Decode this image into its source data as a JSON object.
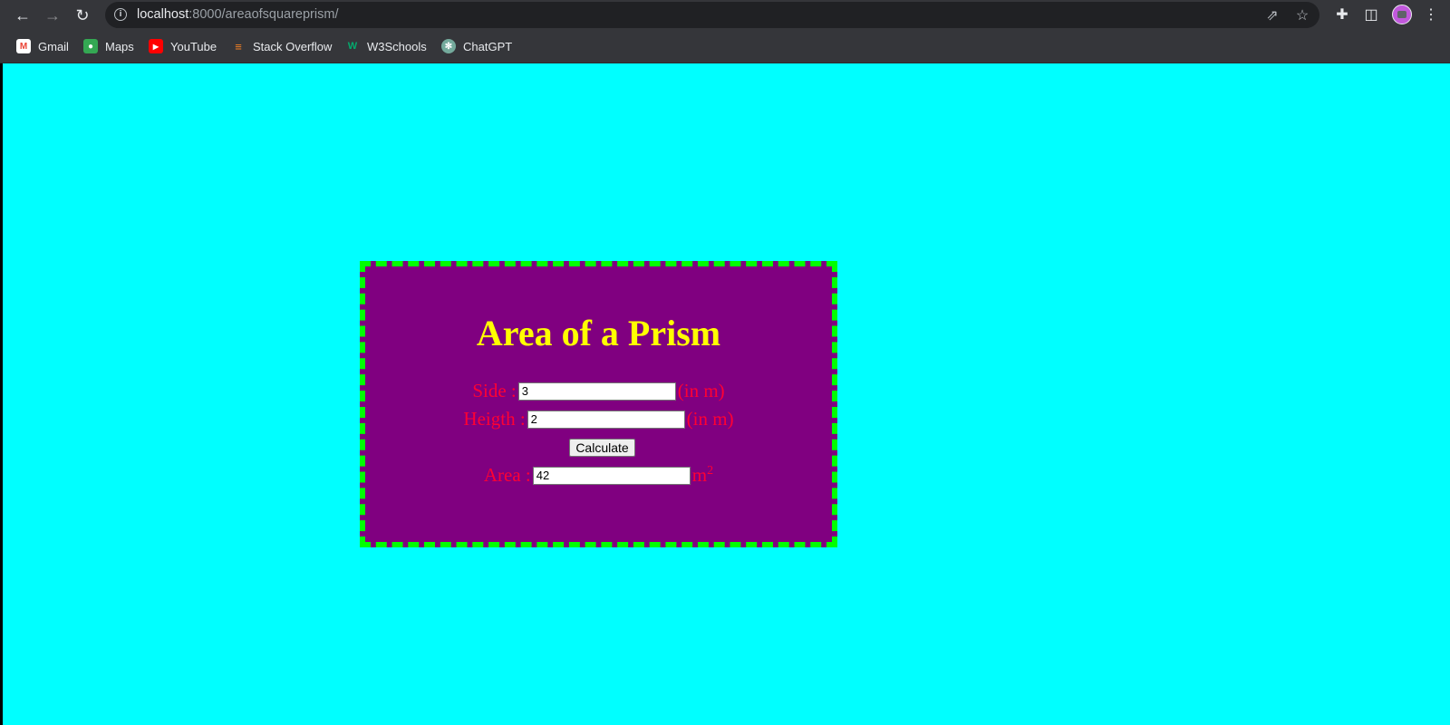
{
  "browser": {
    "url_host": "localhost",
    "url_path": ":8000/areaofsquareprism/",
    "bookmarks": [
      {
        "label": "Gmail",
        "icon": "gmail-icon",
        "color": "#ea4335"
      },
      {
        "label": "Maps",
        "icon": "maps-icon",
        "color": "#34a853"
      },
      {
        "label": "YouTube",
        "icon": "youtube-icon",
        "color": "#ff0000"
      },
      {
        "label": "Stack Overflow",
        "icon": "stackoverflow-icon",
        "color": "#f48024"
      },
      {
        "label": "W3Schools",
        "icon": "w3schools-icon",
        "color": "#04aa6d"
      },
      {
        "label": "ChatGPT",
        "icon": "chatgpt-icon",
        "color": "#74aa9c"
      }
    ]
  },
  "form": {
    "title": "Area of a Prism",
    "side_label": "Side :",
    "side_value": "3",
    "side_unit": "(in m)",
    "height_label": "Heigth :",
    "height_value": "2",
    "height_unit": "(in m)",
    "calculate_label": "Calculate",
    "area_label": "Area :",
    "area_value": "42",
    "area_unit": "m",
    "area_unit_exponent": "2"
  },
  "colors": {
    "page_background": "#00ffff",
    "card_background": "#800080",
    "card_border": "#00ff00",
    "title": "#ffff00",
    "label": "#ff0033"
  }
}
